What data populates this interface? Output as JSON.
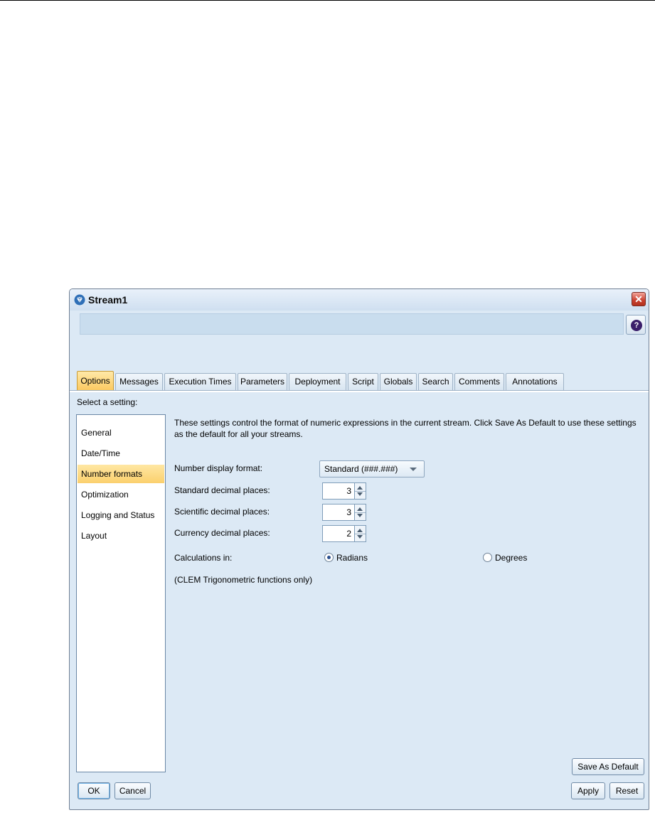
{
  "window": {
    "title": "Stream1",
    "icon": "stream-gem-icon",
    "close_symbol": "✕",
    "help_symbol": "?"
  },
  "tabs": [
    "Options",
    "Messages",
    "Execution Times",
    "Parameters",
    "Deployment",
    "Script",
    "Globals",
    "Search",
    "Comments",
    "Annotations"
  ],
  "active_tab": "Options",
  "select_setting_label": "Select a setting:",
  "settings": [
    "General",
    "Date/Time",
    "Number formats",
    "Optimization",
    "Logging and Status",
    "Layout"
  ],
  "selected_setting": "Number formats",
  "intro_text": "These settings control the format of numeric expressions in the current stream. Click Save As Default to use these settings as the default for all your streams.",
  "number_display_format": {
    "label": "Number display format:",
    "value": "Standard (###.###)"
  },
  "standard_decimal_places": {
    "label": "Standard decimal places:",
    "value": "3"
  },
  "scientific_decimal_places": {
    "label": "Scientific decimal places:",
    "value": "3"
  },
  "currency_decimal_places": {
    "label": "Currency decimal places:",
    "value": "2"
  },
  "calculations": {
    "label": "Calculations in:",
    "options": [
      "Radians",
      "Degrees"
    ],
    "selected": "Radians",
    "note": "(CLEM Trigonometric functions only)"
  },
  "buttons": {
    "save_default": "Save As Default",
    "ok": "OK",
    "cancel": "Cancel",
    "apply": "Apply",
    "reset": "Reset"
  },
  "colors": {
    "dialog_bg": "#dce9f5",
    "selected_bg": "#fbd06d",
    "close_red": "#c9402f"
  }
}
